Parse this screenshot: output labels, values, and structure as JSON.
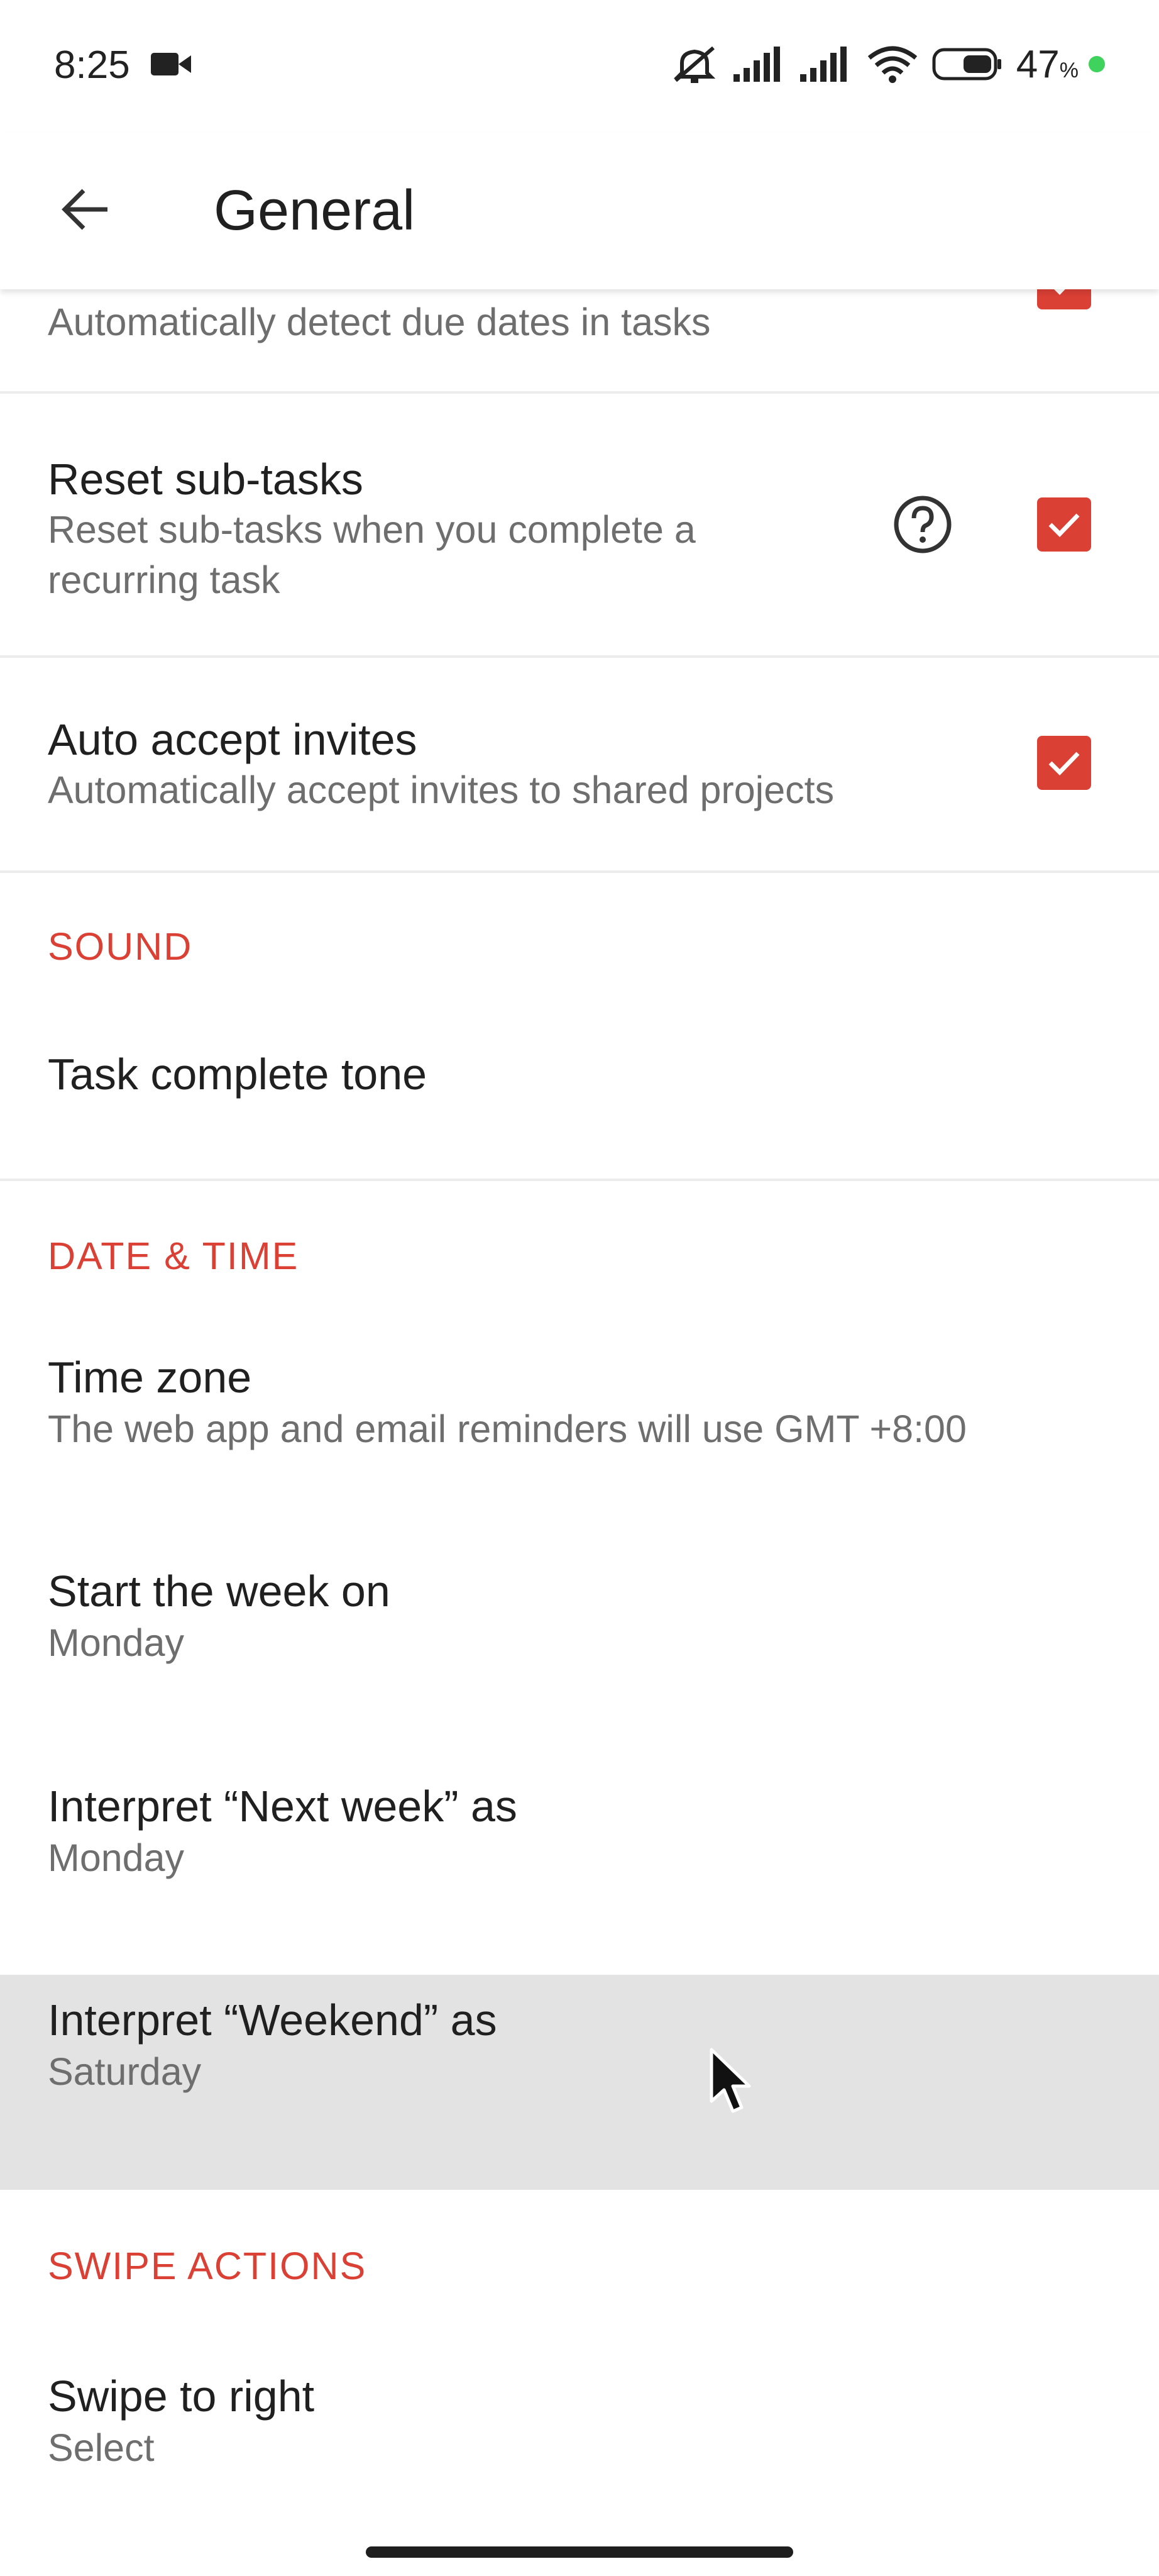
{
  "status_bar": {
    "time": "8:25",
    "battery_percent": "47",
    "battery_unit": "%",
    "icons": [
      "video-camera-icon",
      "mute-icon",
      "signal-icon",
      "signal-icon",
      "wifi-icon",
      "battery-icon",
      "charging-dot-icon"
    ]
  },
  "app_bar": {
    "title": "General",
    "back_icon": "arrow-left-icon"
  },
  "settings": {
    "smart_date": {
      "subtitle": "Automatically detect due dates in tasks",
      "checked": true
    },
    "reset_subtasks": {
      "title": "Reset sub-tasks",
      "subtitle": "Reset sub-tasks when you complete a recurring task",
      "checked": true,
      "help_icon": "help-circle-icon"
    },
    "auto_accept": {
      "title": "Auto accept invites",
      "subtitle": "Automatically accept invites to shared projects",
      "checked": true
    }
  },
  "sections": {
    "sound": {
      "header": "SOUND",
      "task_complete_tone": {
        "title": "Task complete tone"
      }
    },
    "date_time": {
      "header": "DATE & TIME",
      "time_zone": {
        "title": "Time zone",
        "subtitle": "The web app and email reminders will use GMT +8:00"
      },
      "start_week": {
        "title": "Start the week on",
        "subtitle": "Monday"
      },
      "next_week": {
        "title": "Interpret “Next week” as",
        "subtitle": "Monday"
      },
      "weekend": {
        "title": "Interpret “Weekend” as",
        "subtitle": "Saturday"
      }
    },
    "swipe_actions": {
      "header": "SWIPE ACTIONS",
      "swipe_right": {
        "title": "Swipe to right",
        "subtitle": "Select"
      }
    }
  },
  "colors": {
    "accent": "#db4035",
    "highlight": "#e3e3e3",
    "text_primary": "#202020",
    "text_secondary": "#6e6e6e"
  }
}
